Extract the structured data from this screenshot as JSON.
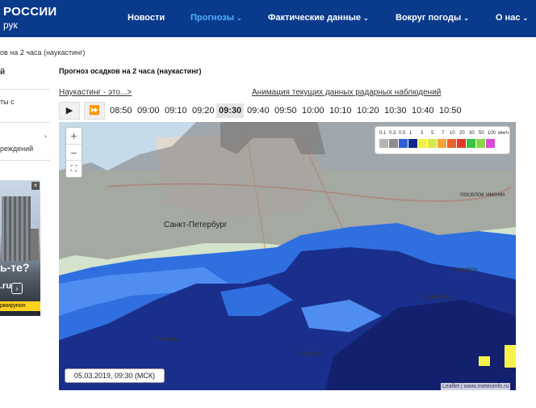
{
  "header": {
    "logo_line1": "РОССИИ",
    "logo_line2": "рук",
    "nav": [
      {
        "label": "Новости",
        "chevron": ""
      },
      {
        "label": "Прогнозы",
        "chevron": "⌄"
      },
      {
        "label": "Фактические данные",
        "chevron": "⌄"
      },
      {
        "label": "Вокруг погоды",
        "chevron": "⌄"
      },
      {
        "label": "О нас",
        "chevron": "⌄"
      }
    ]
  },
  "breadcrumb": "ов на 2 часа (наукастинг)",
  "sidebar": {
    "item1": "й",
    "item2a": "ты с",
    "item3": "реждений",
    "arrow": "›"
  },
  "ad": {
    "question": "ь-те?",
    "domain": ".ru",
    "arrow": "›",
    "strip": "рмирунон",
    "close": "×"
  },
  "page_title": "Прогноз осадков на 2 часа (наукастинг)",
  "links": {
    "nowcasting": "Наукастинг - это...>",
    "animation": "Анимация текущих данных радарных наблюдений"
  },
  "player": {
    "play_icon": "▶",
    "ff_icon": "⏩",
    "times": [
      "08:50",
      "09:00",
      "09:10",
      "09:20",
      "09:30",
      "09:40",
      "09:50",
      "10:00",
      "10:10",
      "10:20",
      "10:30",
      "10:40",
      "10:50"
    ],
    "active_time": "09:30"
  },
  "map": {
    "zoom_in": "+",
    "zoom_out": "−",
    "fullscreen": "⛶",
    "timestamp": "05.03.2019, 09:30 (МСК)",
    "attribution": "Leaflet | www.meteoinfo.ru",
    "places": {
      "spb": "Санкт-Петербург",
      "kirovsk": "Кировск",
      "poselok": "поселок имени",
      "dubrovka": "Дубровка",
      "kolpino": "Колпино",
      "pushkin": "Пушкин"
    },
    "legend": {
      "labels": [
        "0.1",
        "0.3",
        "0.5",
        "1",
        "3",
        "5",
        "7",
        "10",
        "20",
        "30",
        "50",
        "100",
        "мм/ч"
      ],
      "colors": [
        "#b4b4b4",
        "#8c8c8c",
        "#2a5fd8",
        "#0d2a8a",
        "#f5f04a",
        "#d8e84a",
        "#f2a43a",
        "#e8622a",
        "#e03a2a",
        "#3ac24a",
        "#8ad84a",
        "#d84ad8"
      ]
    },
    "colors": {
      "grey": "#8a8a8a",
      "light_grey": "#a8a8a8",
      "blue": "#2f6fe0",
      "dark_blue": "#1a2f8c",
      "navy": "#13206e",
      "yellow": "#f7f24a"
    }
  }
}
